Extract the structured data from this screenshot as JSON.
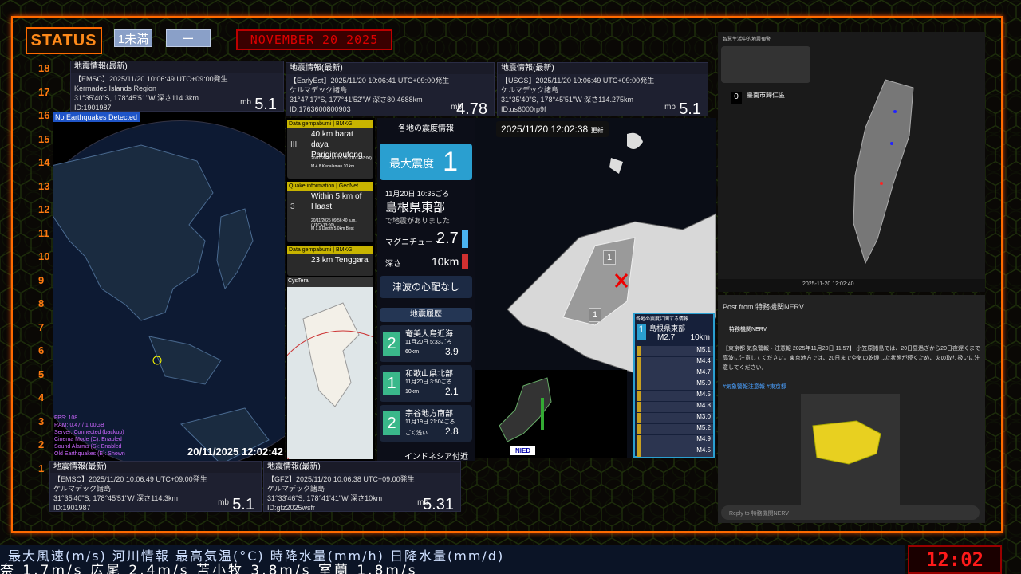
{
  "status": {
    "label": "STATUS",
    "chip1": "1未満",
    "chip2": "ー",
    "date_banner": "NOVEMBER 20  2025"
  },
  "scale": [
    "18",
    "17",
    "16",
    "15",
    "14",
    "13",
    "12",
    "11",
    "10",
    "9",
    "8",
    "7",
    "6",
    "5",
    "4",
    "3",
    "2",
    "1"
  ],
  "quakes": [
    {
      "hd": "地震情報(最新)",
      "l1": "【EMSC】2025/11/20 10:06:49 UTC+09:00発生",
      "l2": "Kermadec Islands Region",
      "l3": "31°35'40\"S, 178°45'51\"W  深さ114.3km",
      "l4": "ID:1901987",
      "mb": "mb",
      "mag": "5.1"
    },
    {
      "hd": "地震情報(最新)",
      "l1": "【EarlyEst】2025/11/20 10:06:41 UTC+09:00発生",
      "l2": "ケルマデック諸島",
      "l3": "31°47'17\"S, 177°41'52\"W  深さ80.4688km",
      "l4": "ID:1763600800903",
      "mb": "mb",
      "mag": "4.78"
    },
    {
      "hd": "地震情報(最新)",
      "l1": "【USGS】2025/11/20 10:06:49 UTC+09:00発生",
      "l2": "ケルマデック諸島",
      "l3": "31°35'40\"S, 178°45'51\"W  深さ114.275km",
      "l4": "ID:us6000rp9f",
      "mb": "mb",
      "mag": "5.1"
    },
    {
      "hd": "地震情報(最新)",
      "l1": "【EMSC】2025/11/20 10:06:49 UTC+09:00発生",
      "l2": "ケルマデック諸島",
      "l3": "31°35'40\"S, 178°45'51\"W  深さ114.3km",
      "l4": "ID:1901987",
      "mb": "mb",
      "mag": "5.1"
    },
    {
      "hd": "地震情報(最新)",
      "l1": "【GFZ】2025/11/20 10:06:38 UTC+09:00発生",
      "l2": "ケルマデック諸島",
      "l3": "31°33'46\"S, 178°41'41\"W  深さ10km",
      "l4": "ID:gfz2025wsfr",
      "mb": "mb",
      "mag": "5.31"
    }
  ],
  "globe": {
    "no_eq": "No Earthquakes Detected",
    "time": "20/11/2025 12:02:42",
    "stats": [
      "FPS: 108",
      "RAM: 0.47 / 1.00GB",
      "Server: Connected (backup)",
      "Cinema Mode (C): Enabled",
      "Sound Alarms (S): Enabled",
      "Old Earthquakes (E): Shown"
    ]
  },
  "indo": [
    {
      "title": "Data gempabumi | BMKG",
      "main": "40 km barat daya Parigimoutong",
      "sub": "20/11/2025 07:15:39 (UTC+07:00)",
      "sub2": "M 4.8  Kedalaman 10 km",
      "side": "III"
    },
    {
      "title": "Quake information | GeoNet",
      "main": "Within 5 km of Haast",
      "sub": "20/11/2025 09:56:40 a.m. (UTC+13:00)",
      "sub2": "M 1.9  Depth 5.0km  Best",
      "side": "3"
    },
    {
      "title": "Data gempabumi | BMKG",
      "main": "23 km Tenggara",
      "sub": "",
      "sub2": "",
      "side": ""
    }
  ],
  "jp": {
    "section1": "各地の震度情報",
    "maxint_label": "最大震度",
    "maxint": "1",
    "time": "11月20日 10:35ごろ",
    "place": "島根県東部",
    "note": "で地震がありました",
    "mag_label": "マグニチュード",
    "mag": "2.7",
    "depth_label": "深さ",
    "depth": "10km",
    "tsunami": "津波の心配なし",
    "history_label": "地震履歴",
    "history": [
      {
        "int": "2",
        "place": "奄美大島近海",
        "time": "11月20日 5:33ごろ",
        "depth": "60km",
        "mag": "3.9"
      },
      {
        "int": "1",
        "place": "和歌山県北部",
        "time": "11月20日 3:50ごろ",
        "depth": "10km",
        "mag": "2.1"
      },
      {
        "int": "2",
        "place": "宗谷地方南部",
        "time": "11月19日 21:04ごろ",
        "depth": "ごく浅い",
        "mag": "2.8"
      }
    ],
    "last": "インドネシア付近"
  },
  "map": {
    "time": "2025/11/20  12:02:38",
    "upd": "更新",
    "badge": "1",
    "popup_title": "各地の震度に関する情報",
    "popup_place": "島根県東部",
    "popup_mag": "M2.7",
    "popup_depth": "10km",
    "list": [
      {
        "m": "M5.1"
      },
      {
        "m": "M4.4"
      },
      {
        "m": "M4.7"
      },
      {
        "m": "M5.0"
      },
      {
        "m": "M4.5"
      },
      {
        "m": "M4.8"
      },
      {
        "m": "M3.0"
      },
      {
        "m": "M5.2"
      },
      {
        "m": "M4.9"
      },
      {
        "m": "M4.5"
      }
    ],
    "nied": "NIED"
  },
  "taiwan": {
    "title": "智慧生活中的地震預警",
    "count": "0",
    "place": "臺南市歸仁區",
    "foot_time": "2025-11-20 12:02:40"
  },
  "tweet": {
    "head": "Post from 特務機関NERV",
    "name": "特務機関NERV",
    "body": "【東京都 気象警報・注意報 2025年11月20日 11:57】 小笠原諸島では、20日昼過ぎから20日夜遅くまで高波に注意してください。東京地方では、20日まで空気の乾燥した状態が続くため、火の取り扱いに注意してください。",
    "tags": "#気象警報注意報 #東京都",
    "reply": "Reply to 特務機関NERV"
  },
  "ticker": {
    "row1": "最大風速(m/s)  河川情報    最高気温(°C)   時降水量(mm/h)   日降水量(mm/d)",
    "row2": "奈 1.7m/s    広尾 2.4m/s    苫小牧 3.8m/s    室蘭 1.8m/s"
  },
  "clock": "12:02"
}
